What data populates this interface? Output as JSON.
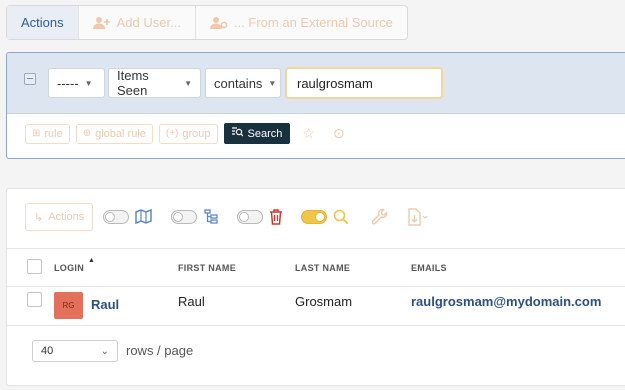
{
  "topbar": {
    "actions_label": "Actions",
    "add_user_label": "Add User...",
    "external_label": "... From an External Source"
  },
  "criteria": {
    "field1_value": "-----",
    "field2_value": "Items Seen",
    "operator_value": "contains",
    "search_value": "raulgrosmam",
    "rule_label": "rule",
    "global_rule_label": "global rule",
    "group_label": "group",
    "search_button_label": "Search"
  },
  "results": {
    "actions_label": "Actions",
    "columns": {
      "login": "LOGIN",
      "first_name": "FIRST NAME",
      "last_name": "LAST NAME",
      "emails": "EMAILS"
    },
    "rows": [
      {
        "initials": "RG",
        "login": "Raul",
        "first_name": "Raul",
        "last_name": "Grosmam",
        "email": "raulgrosmam@mydomain.com"
      }
    ],
    "page_size": "40",
    "rows_per_page_label": "rows / page"
  },
  "colors": {
    "accent": "#2f5b9c",
    "faded_orange": "#f0c9ad",
    "search_button": "#19303f",
    "avatar": "#e3705a",
    "toggle_on": "#f0c64a",
    "trash_red": "#d9342b"
  }
}
